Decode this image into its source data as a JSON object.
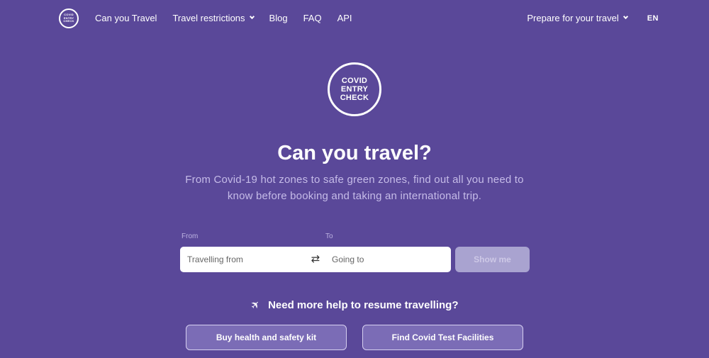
{
  "nav": {
    "logo_lines": [
      "COVID",
      "ENTRY",
      "CHECK"
    ],
    "links": [
      {
        "label": "Can you Travel"
      },
      {
        "label": "Travel restrictions",
        "has_dropdown": true
      },
      {
        "label": "Blog"
      },
      {
        "label": "FAQ"
      },
      {
        "label": "API"
      }
    ],
    "prepare": {
      "label": "Prepare for your travel",
      "has_dropdown": true
    },
    "language": "EN"
  },
  "hero": {
    "logo_lines": [
      "COVID",
      "ENTRY",
      "CHECK"
    ],
    "title": "Can you travel?",
    "subtitle": "From Covid-19 hot zones to safe green zones, find out all you need to know before booking and taking an international trip."
  },
  "search": {
    "from_label": "From",
    "to_label": "To",
    "from_placeholder": "Travelling from",
    "to_placeholder": "Going to",
    "from_value": "",
    "to_value": "",
    "swap_icon": "swap-arrows-icon",
    "submit_label": "Show me"
  },
  "help": {
    "icon": "airplane-icon",
    "heading": "Need more help to resume travelling?",
    "buttons": [
      {
        "label": "Buy health and safety kit"
      },
      {
        "label": "Find Covid Test Facilities"
      }
    ]
  },
  "colors": {
    "background": "#5a4899",
    "subtitle": "#c5bbe8",
    "submit_disabled": "#a9a3d0",
    "action_button": "#7b6cb6"
  }
}
